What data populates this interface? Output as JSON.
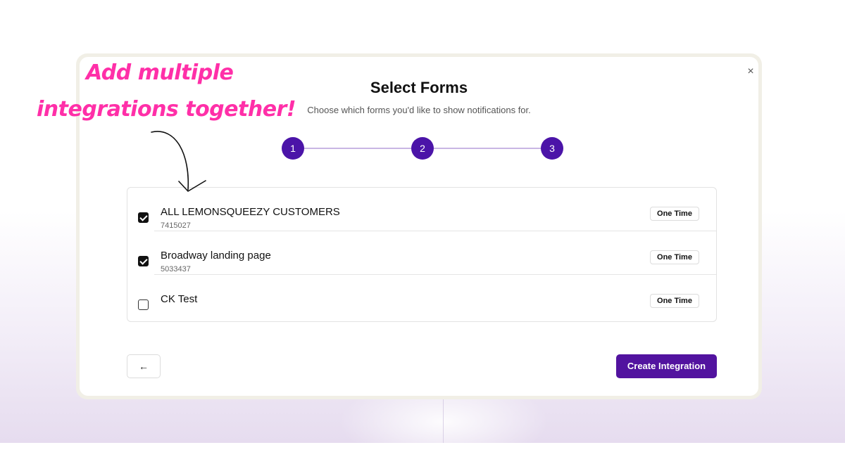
{
  "annotation": {
    "line1": "Add multiple",
    "line2": "integrations together!",
    "color": "#ff2fa8"
  },
  "modal": {
    "close_icon": "×",
    "title": "Select Forms",
    "subtitle": "Choose which forms you'd like to show notifications for.",
    "steps": [
      "1",
      "2",
      "3"
    ],
    "accent_color": "#4b14a8"
  },
  "forms": [
    {
      "name": "ALL LEMONSQUEEZY CUSTOMERS",
      "id": "7415027",
      "badge": "One Time",
      "checked": true
    },
    {
      "name": "Broadway landing page",
      "id": "5033437",
      "badge": "One Time",
      "checked": true
    },
    {
      "name": "CK Test",
      "id": "",
      "badge": "One Time",
      "checked": false
    }
  ],
  "footer": {
    "back_icon": "←",
    "create_label": "Create Integration"
  }
}
